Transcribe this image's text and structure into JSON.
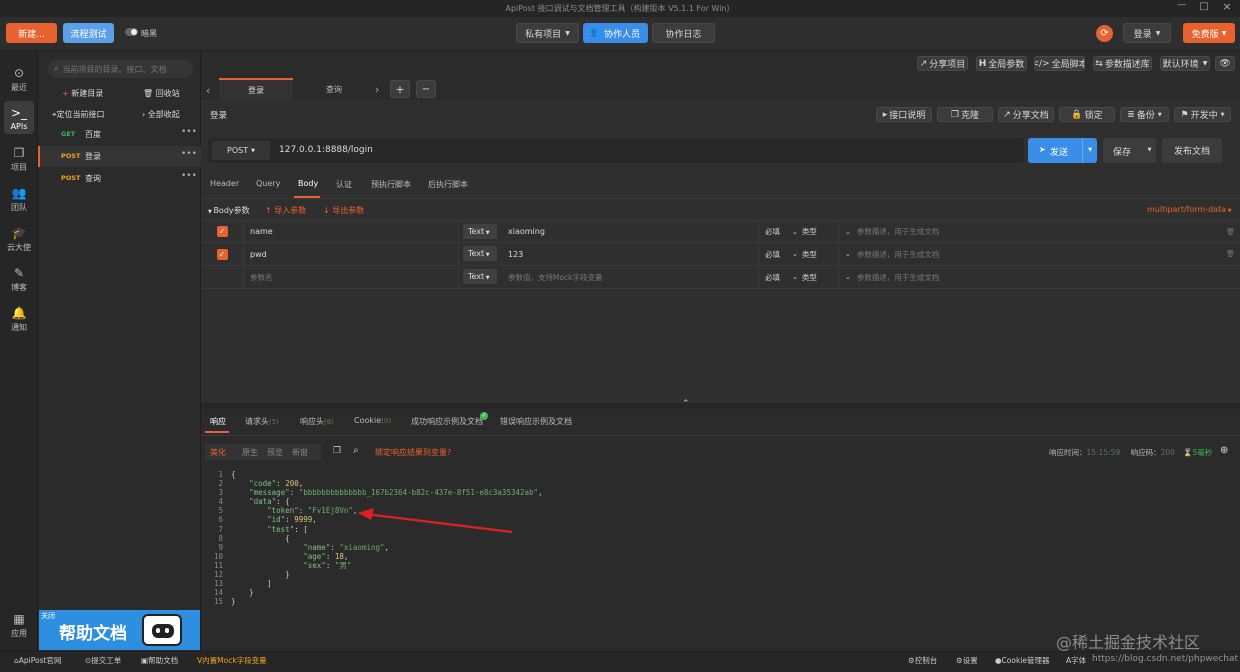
{
  "titlebar": {
    "title": "ApiPost 接口调试与文档管理工具（构建版本 V5.1.1 For Win）"
  },
  "topbar": {
    "new_label": "新建...",
    "flow_test_label": "流程测试",
    "theme_label": "暗黑",
    "private_project_label": "私有项目",
    "collaborators_label": "协作人员",
    "collab_log_label": "协作日志",
    "login_label": "登录",
    "free_label": "免费版"
  },
  "left_nav": [
    {
      "icon": "clock-icon",
      "label": "最近"
    },
    {
      "icon": "terminal-icon",
      "label": "APIs"
    },
    {
      "icon": "layers-icon",
      "label": "项目"
    },
    {
      "icon": "team-icon",
      "label": "团队"
    },
    {
      "icon": "graduation-cap-icon",
      "label": "云大使"
    },
    {
      "icon": "edit-icon",
      "label": "博客"
    },
    {
      "icon": "bell-icon",
      "label": "通知"
    }
  ],
  "left_nav_bottom": {
    "label": "应用"
  },
  "sidebar": {
    "search_placeholder": "当前项目的目录、接口、文档",
    "new_dir_label": "新建目录",
    "recycle_label": "回收站",
    "locate_label": "定位当前接口",
    "collapse_label": "全部收起",
    "items": [
      {
        "method": "GET",
        "name": "百度"
      },
      {
        "method": "POST",
        "name": "登录"
      },
      {
        "method": "POST",
        "name": "查询"
      }
    ],
    "banner_close": "关闭",
    "banner_title": "帮助文档"
  },
  "toolbar_right": {
    "share_project": "分享项目",
    "global_params": "全局参数",
    "global_script": "全局脚本",
    "param_desc_lib": "参数描述库",
    "default_env": "默认环境"
  },
  "tabs": [
    {
      "label": "登录"
    },
    {
      "label": "查询"
    }
  ],
  "tab_controls": {
    "add": "+",
    "remove": "−"
  },
  "request": {
    "title": "登录",
    "doc_btn": "接口说明",
    "clone_btn": "克隆",
    "share_btn": "分享文档",
    "lock_btn": "锁定",
    "backup_btn": "备份",
    "status_btn": "开发中",
    "method": "POST",
    "url": "127.0.0.1:8888/login",
    "send_label": "发送",
    "save_label": "保存",
    "publish_label": "发布文档"
  },
  "req_tabs": [
    "Header",
    "Query",
    "Body",
    "认证",
    "预执行脚本",
    "后执行脚本"
  ],
  "body": {
    "section_label": "Body参数",
    "import_label": "导入参数",
    "export_label": "导出参数",
    "content_type": "multipart/form-data",
    "params": [
      {
        "name": "name",
        "type": "Text",
        "value": "xiaoming",
        "required": "必填",
        "kind": "类型",
        "desc_placeholder": "参数描述，用于生成文档"
      },
      {
        "name": "pwd",
        "type": "Text",
        "value": "123",
        "required": "必填",
        "kind": "类型",
        "desc_placeholder": "参数描述，用于生成文档"
      }
    ],
    "new_row": {
      "name_placeholder": "参数名",
      "type": "Text",
      "value_placeholder": "参数值，支持Mock字段变量",
      "required": "必填",
      "kind": "类型",
      "desc_placeholder": "参数描述，用于生成文档"
    }
  },
  "response": {
    "tabs": [
      {
        "label": "响应"
      },
      {
        "label": "请求头",
        "count": "(5)"
      },
      {
        "label": "响应头",
        "count": "(6)"
      },
      {
        "label": "Cookie",
        "count": "(0)"
      },
      {
        "label": "成功响应示例及文档"
      },
      {
        "label": "错误响应示例及文档"
      }
    ],
    "view_modes": [
      "美化",
      "原生",
      "预览",
      "新窗"
    ],
    "bind_label": "绑定响应结果到变量?",
    "time_label": "响应时间：",
    "time_value": "15:15:59",
    "code_label": "响应码：",
    "code_value": "200",
    "duration_value": "5毫秒",
    "lines": [
      "{",
      "    \"code\": 200,",
      "    \"message\": \"bbbbbbbbbbbbbb_167b2364-b82c-437e-8f51-e8c3a35342ab\",",
      "    \"data\": {",
      "        \"token\": \"Fv1Ej8Vn\",",
      "        \"id\": 9999,",
      "        \"test\": [",
      "            {",
      "                \"name\": \"xiaoming\",",
      "                \"age\": 18,",
      "                \"sex\": \"男\"",
      "            }",
      "        ]",
      "    }",
      "}"
    ]
  },
  "statusbar": {
    "official_site": "ApiPost官网",
    "submit_ticket": "提交工单",
    "help_doc": "帮助文档",
    "mock_fields": "内置Mock字段变量",
    "console": "控制台",
    "settings": "设置",
    "cookie_mgr": "Cookie管理器",
    "font": "字体"
  },
  "watermark": {
    "text": "@稀土掘金技术社区",
    "url": "https://blog.csdn.net/phpwechat"
  },
  "colors": {
    "accent": "#e8622f",
    "blue": "#3b8ee8",
    "get": "#3cba54",
    "post": "#f0a422",
    "green": "#7ec07e"
  }
}
